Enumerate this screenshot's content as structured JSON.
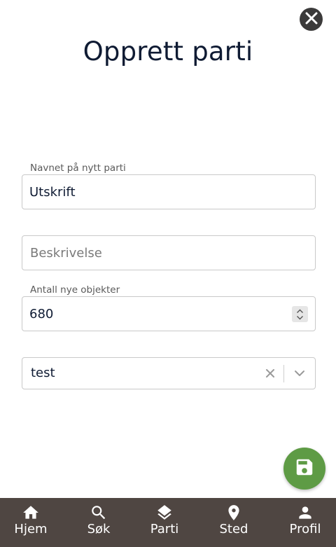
{
  "header": {
    "title": "Opprett parti",
    "close_icon": "close-icon"
  },
  "form": {
    "name_label": "Navnet på nytt parti",
    "name_value": "Utskrift",
    "description_placeholder": "Beskrivelse",
    "description_value": "",
    "count_label": "Antall nye objekter",
    "count_value": "680",
    "select_value": "test"
  },
  "fab": {
    "icon": "save-icon",
    "color": "#5e9b45"
  },
  "bottom_nav": {
    "background": "#4f4642",
    "items": [
      {
        "label": "Hjem",
        "icon": "home-icon"
      },
      {
        "label": "Søk",
        "icon": "search-icon"
      },
      {
        "label": "Parti",
        "icon": "layers-icon"
      },
      {
        "label": "Sted",
        "icon": "location-pin-icon"
      },
      {
        "label": "Profil",
        "icon": "person-icon"
      }
    ]
  }
}
